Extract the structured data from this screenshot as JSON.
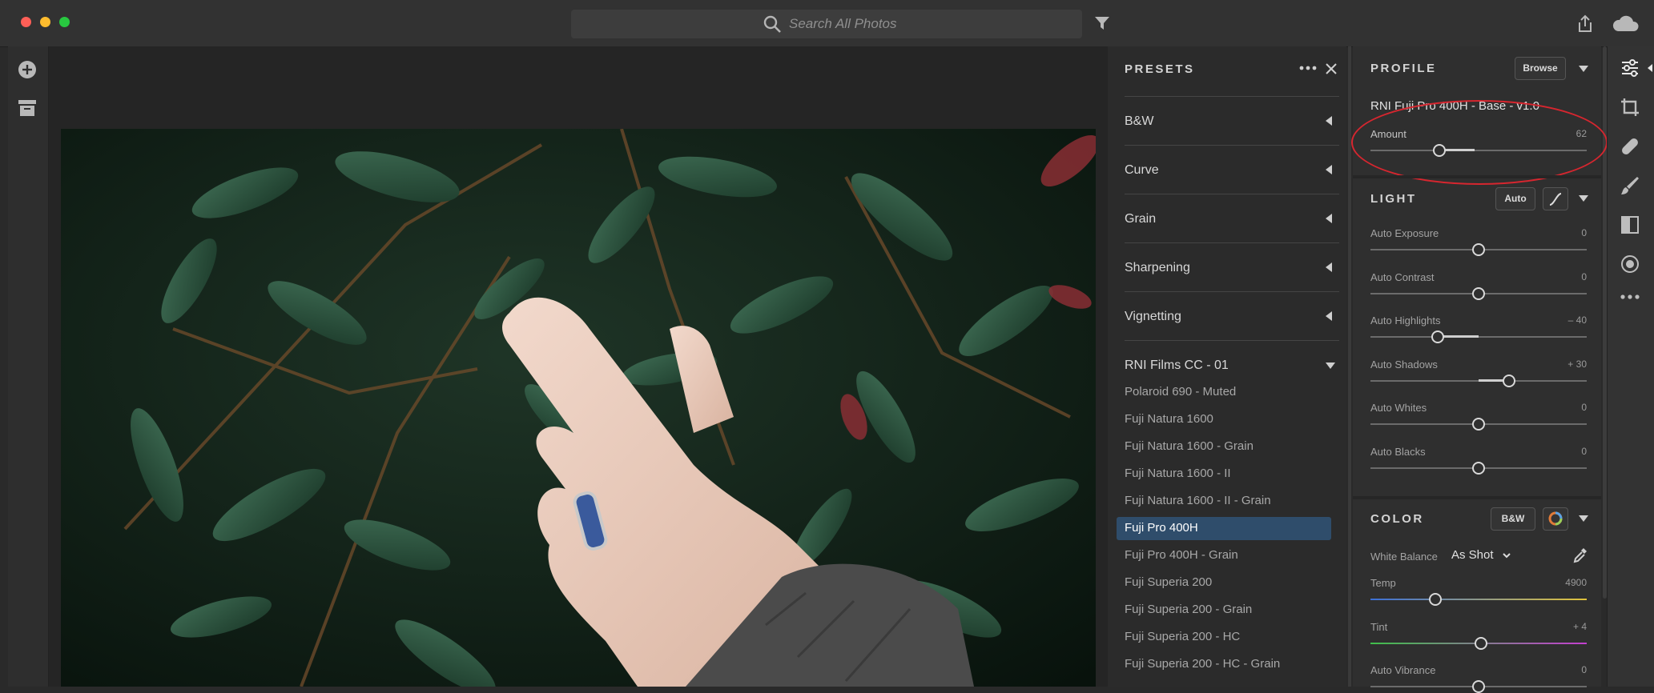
{
  "toolbar": {
    "search_placeholder": "Search All Photos"
  },
  "presets": {
    "title": "PRESETS",
    "categories": [
      {
        "label": "B&W"
      },
      {
        "label": "Curve"
      },
      {
        "label": "Grain"
      },
      {
        "label": "Sharpening"
      },
      {
        "label": "Vignetting"
      }
    ],
    "group": {
      "label": "RNI Films CC - 01",
      "items": [
        "Polaroid 690 - Muted",
        "Fuji Natura 1600",
        "Fuji Natura 1600 - Grain",
        "Fuji Natura 1600 - II",
        "Fuji Natura 1600 - II - Grain",
        "Fuji Pro 400H",
        "Fuji Pro 400H - Grain",
        "Fuji Superia 200",
        "Fuji Superia 200 - Grain",
        "Fuji Superia 200 - HC",
        "Fuji Superia 200 - HC - Grain"
      ],
      "selected_index": 5
    }
  },
  "profile": {
    "title": "PROFILE",
    "browse_label": "Browse",
    "name": "RNI Fuji Pro 400H - Base - v1.0",
    "amount_label": "Amount",
    "amount_value": "62",
    "amount_fraction": 0.32
  },
  "light": {
    "title": "LIGHT",
    "auto_label": "Auto",
    "sliders": [
      {
        "label": "Auto Exposure",
        "value": "0",
        "fraction": 0.5
      },
      {
        "label": "Auto Contrast",
        "value": "0",
        "fraction": 0.5
      },
      {
        "label": "Auto Highlights",
        "value": "– 40",
        "fraction": 0.31
      },
      {
        "label": "Auto Shadows",
        "value": "+ 30",
        "fraction": 0.64
      },
      {
        "label": "Auto Whites",
        "value": "0",
        "fraction": 0.5
      },
      {
        "label": "Auto Blacks",
        "value": "0",
        "fraction": 0.5
      }
    ]
  },
  "color": {
    "title": "COLOR",
    "bw_label": "B&W",
    "wb_label": "White Balance",
    "wb_value": "As Shot",
    "sliders": [
      {
        "label": "Temp",
        "value": "4900",
        "fraction": 0.3
      },
      {
        "label": "Tint",
        "value": "+ 4",
        "fraction": 0.51
      },
      {
        "label": "Auto Vibrance",
        "value": "0",
        "fraction": 0.5
      }
    ]
  },
  "colors": {
    "accent": "#2f4d6b",
    "annotation": "#d6262f"
  }
}
